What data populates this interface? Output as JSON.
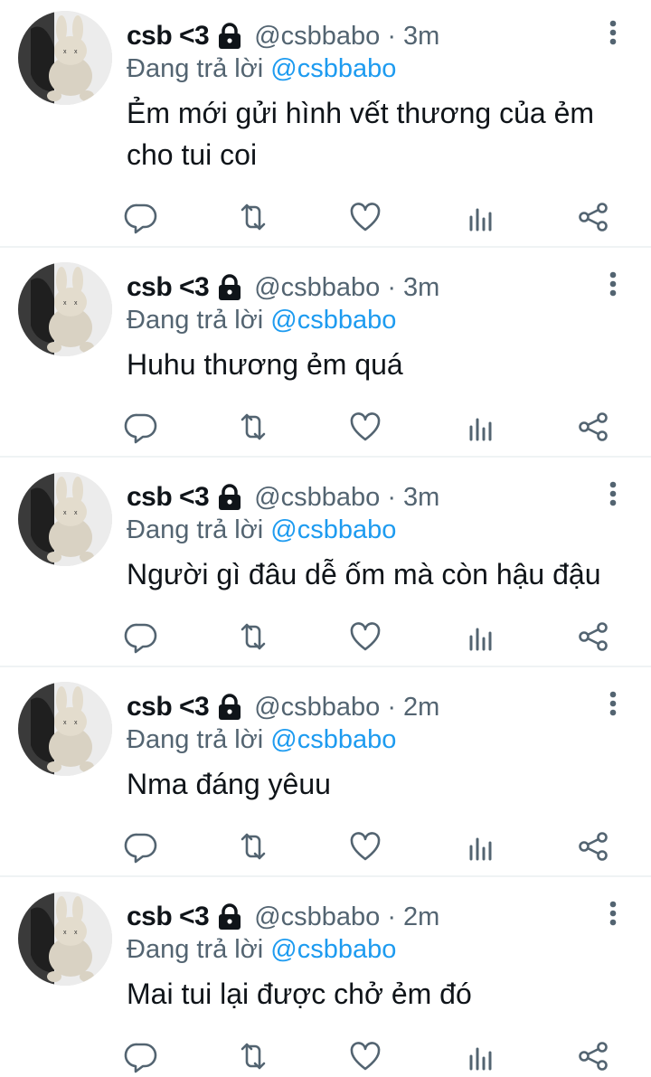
{
  "tweets": [
    {
      "name": "csb <3",
      "handle": "@csbbabo",
      "sep": "·",
      "time": "3m",
      "reply_prefix": "Đang trả lời",
      "reply_to": "@csbbabo",
      "text": "Ẻm mới gửi hình vết thương của ẻm cho tui coi"
    },
    {
      "name": "csb <3",
      "handle": "@csbbabo",
      "sep": "·",
      "time": "3m",
      "reply_prefix": "Đang trả lời",
      "reply_to": "@csbbabo",
      "text": "Huhu thương ẻm quá"
    },
    {
      "name": "csb <3",
      "handle": "@csbbabo",
      "sep": "·",
      "time": "3m",
      "reply_prefix": "Đang trả lời",
      "reply_to": "@csbbabo",
      "text": "Người gì đâu dễ ốm mà còn hậu đậu"
    },
    {
      "name": "csb <3",
      "handle": "@csbbabo",
      "sep": "·",
      "time": "2m",
      "reply_prefix": "Đang trả lời",
      "reply_to": "@csbbabo",
      "text": "Nma đáng yêuu"
    },
    {
      "name": "csb <3",
      "handle": "@csbbabo",
      "sep": "·",
      "time": "2m",
      "reply_prefix": "Đang trả lời",
      "reply_to": "@csbbabo",
      "text": "Mai tui lại được chở ẻm đó"
    }
  ],
  "icons": {
    "avatar": "bunny-plush-avatar",
    "lock": "lock-icon",
    "more": "more-vertical-icon",
    "reply": "reply-icon",
    "retweet": "retweet-icon",
    "like": "heart-icon",
    "views": "analytics-icon",
    "share": "share-icon"
  },
  "colors": {
    "text": "#0f1419",
    "secondary": "#536471",
    "accent": "#1d9bf0",
    "divider": "#eff3f4"
  }
}
